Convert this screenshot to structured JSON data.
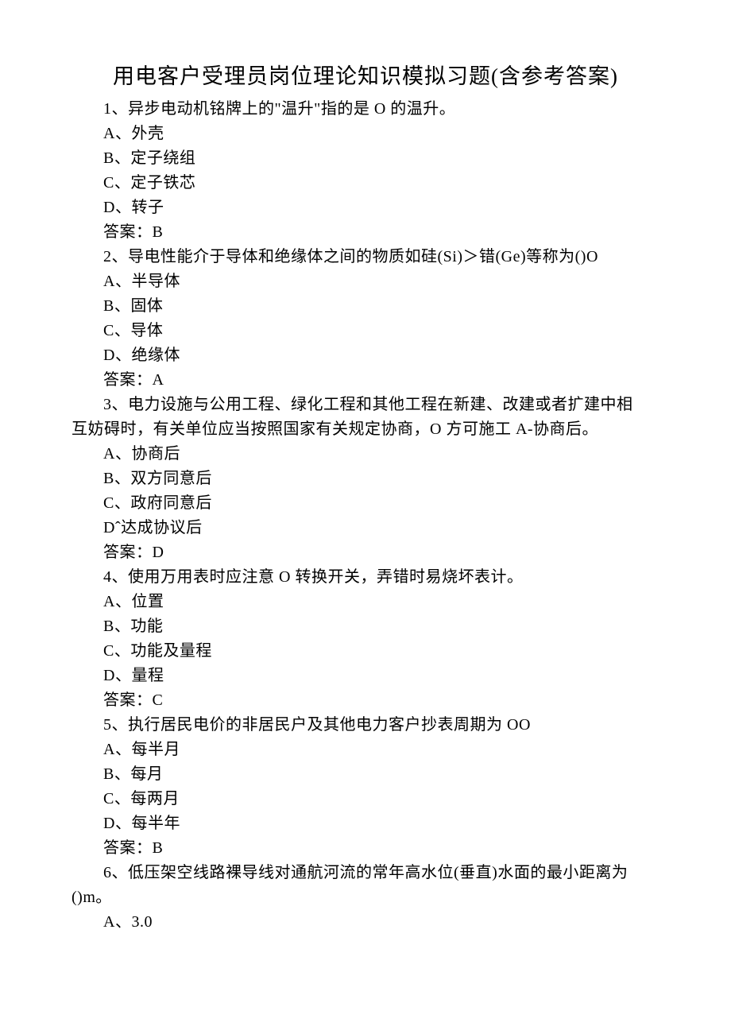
{
  "title": "用电客户受理员岗位理论知识模拟习题(含参考答案)",
  "q1": {
    "stem": "1、异步电动机铭牌上的\"温升\"指的是 O 的温升。",
    "a": "A、外壳",
    "b": "B、定子绕组",
    "c": "C、定子铁芯",
    "d": "D、转子",
    "ans": "答案：B"
  },
  "q2": {
    "stem": "2、导电性能介于导体和绝缘体之间的物质如硅(Si)＞错(Ge)等称为()O",
    "a": "A、半导体",
    "b": "B、固体",
    "c": "C、导体",
    "d": "D、绝缘体",
    "ans": "答案：A"
  },
  "q3": {
    "stem1": "3、电力设施与公用工程、绿化工程和其他工程在新建、改建或者扩建中相",
    "stem2": "互妨碍时，有关单位应当按照国家有关规定协商，O 方可施工 A-协商后。",
    "a": "A、协商后",
    "b": "B、双方同意后",
    "c": "C、政府同意后",
    "d": "Dˆ达成协议后",
    "ans": "答案：D"
  },
  "q4": {
    "stem": "4、使用万用表时应注意 O 转换开关，弄错时易烧坏表计。",
    "a": "A、位置",
    "b": "B、功能",
    "c": "C、功能及量程",
    "d": "D、量程",
    "ans": "答案：C"
  },
  "q5": {
    "stem": "5、执行居民电价的非居民户及其他电力客户抄表周期为 OO",
    "a": "A、每半月",
    "b": "B、每月",
    "c": "C、每两月",
    "d": "D、每半年",
    "ans": "答案：B"
  },
  "q6": {
    "stem1": "6、低压架空线路裸导线对通航河流的常年高水位(垂直)水面的最小距离为",
    "stem2": "()m｡",
    "a": "A、3.0"
  }
}
